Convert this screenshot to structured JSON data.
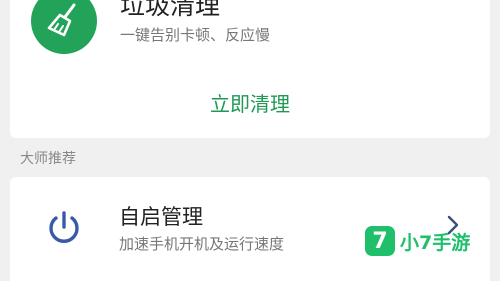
{
  "clean_card": {
    "icon": "broom-icon",
    "title": "垃圾清理",
    "subtitle": "一键告别卡顿、反应慢",
    "action_label": "立即清理"
  },
  "section": {
    "label": "大师推荐"
  },
  "recommend_item": {
    "icon": "power-icon",
    "title": "自启管理",
    "subtitle": "加速手机开机及运行速度",
    "chevron_icon": "chevron-right-icon"
  },
  "watermark": {
    "badge": "7",
    "text": "小7手游"
  },
  "colors": {
    "accent_green": "#23a35a",
    "power_blue": "#3a5aa8",
    "watermark_green": "#1fbf6b"
  }
}
